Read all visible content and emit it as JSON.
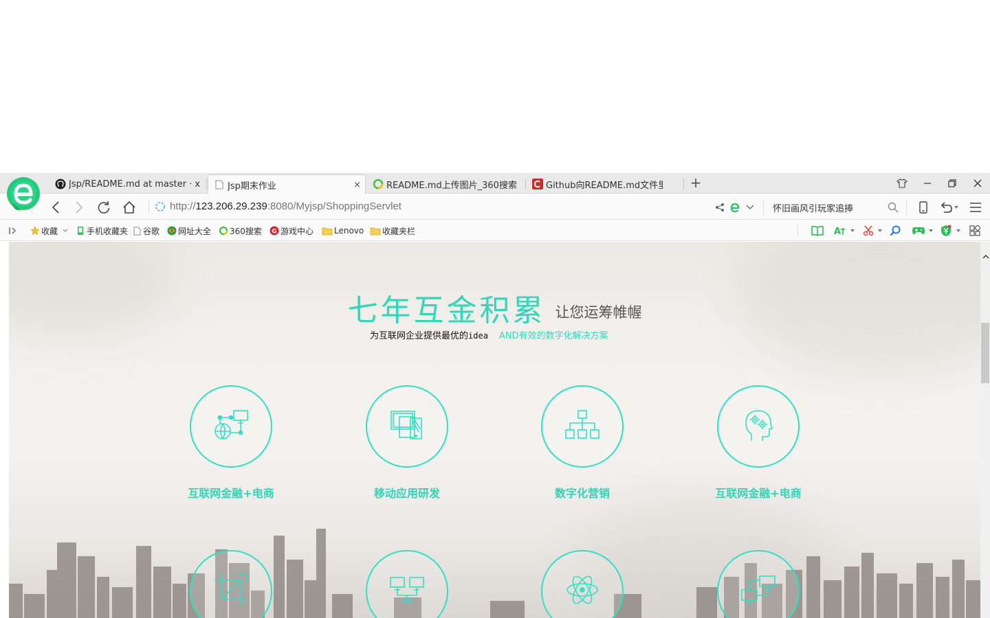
{
  "tabs": [
    {
      "label": "Jsp/README.md at master · x",
      "icon": "github-icon"
    },
    {
      "label": "Jsp期末作业",
      "icon": "page-icon",
      "close": "×"
    },
    {
      "label": "README.md上传图片_360搜索",
      "icon": "360-search-icon"
    },
    {
      "label": "Github向README.md文件里传",
      "icon": "csdn-icon"
    }
  ],
  "new_tab_label": "+",
  "address": {
    "prefix": "http://",
    "host": "123.206.29.239",
    "rest": ":8080/Myjsp/ShoppingServlet"
  },
  "search": {
    "value": "怀旧画风引玩家追捧"
  },
  "bookmarks": [
    {
      "label": "收藏",
      "icon": "star-icon"
    },
    {
      "label": "手机收藏夹",
      "icon": "phone-icon"
    },
    {
      "label": "谷歌",
      "icon": "page-icon"
    },
    {
      "label": "网址大全",
      "icon": "globe-icon"
    },
    {
      "label": "360搜索",
      "icon": "360-search-icon"
    },
    {
      "label": "游戏中心",
      "icon": "game-center-icon"
    },
    {
      "label": "Lenovo",
      "icon": "folder-icon"
    },
    {
      "label": "收藏夹栏",
      "icon": "folder-icon"
    }
  ],
  "hero": {
    "title": "七年互金积累",
    "side": "让您运筹帷幄",
    "sub_a": "为互联网企业提供最优的",
    "sub_b": "idea",
    "sub_c": "AND有效的数字化解决方案"
  },
  "services": [
    {
      "label": "互联网金融+电商",
      "icon": "globe-network-icon"
    },
    {
      "label": "移动应用研发",
      "icon": "devices-icon"
    },
    {
      "label": "数字化营销",
      "icon": "hierarchy-icon"
    },
    {
      "label": "互联网金融+电商",
      "icon": "head-gears-icon"
    },
    {
      "label": "",
      "icon": "crop-icon"
    },
    {
      "label": "",
      "icon": "network-computers-icon"
    },
    {
      "label": "",
      "icon": "atom-icon"
    },
    {
      "label": "",
      "icon": "connected-screens-icon"
    }
  ],
  "colors": {
    "accent": "#34d6ba",
    "ring": "#2fe0c4"
  }
}
